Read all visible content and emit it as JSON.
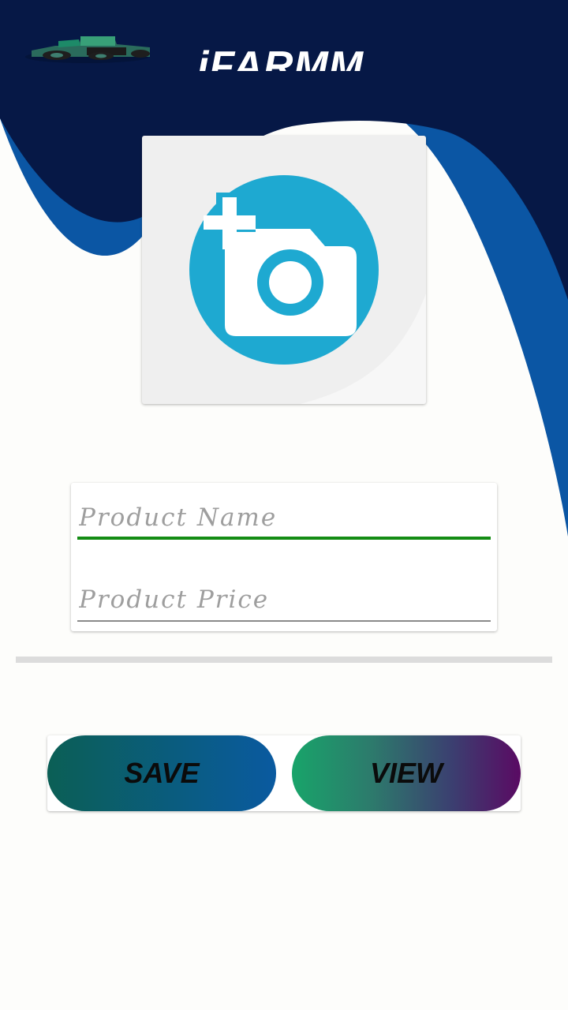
{
  "header": {
    "app_title": "iFARMM",
    "logo_icon": "tractor-icon"
  },
  "photo_picker": {
    "icon": "add-photo-camera-icon",
    "icon_color": "#1ea9d1"
  },
  "form": {
    "product_name": {
      "value": "",
      "placeholder": "Product Name"
    },
    "product_price": {
      "value": "",
      "placeholder": "Product Price"
    }
  },
  "buttons": {
    "save_label": "SAVE",
    "view_label": "VIEW"
  },
  "colors": {
    "header_navy": "#061846",
    "wave_blue": "#0b56a4",
    "active_field_underline": "#148c14",
    "accent_camera": "#1ea9d1"
  }
}
